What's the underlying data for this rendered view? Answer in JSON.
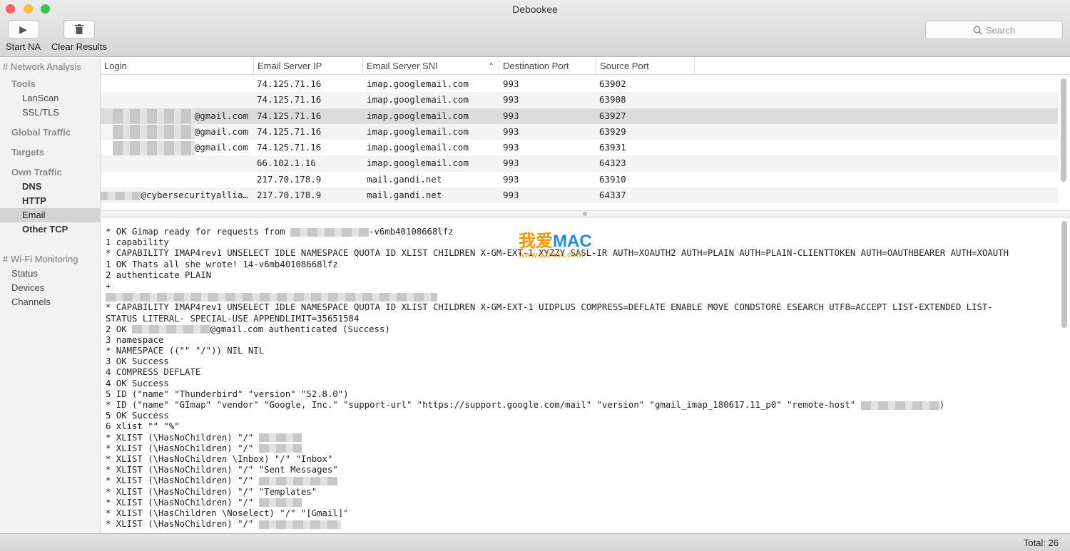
{
  "window": {
    "title": "Debookee"
  },
  "toolbar": {
    "start_label": "Start NA",
    "clear_label": "Clear Results",
    "search_placeholder": "Search"
  },
  "sidebar": {
    "network_analysis": "# Network Analysis",
    "tools": "Tools",
    "lanscan": "LanScan",
    "ssltls": "SSL/TLS",
    "global_traffic": "Global Traffic",
    "targets": "Targets",
    "own_traffic": "Own Traffic",
    "dns": "DNS",
    "http": "HTTP",
    "email": "Email",
    "other_tcp": "Other TCP",
    "wifi": "# Wi-Fi Monitoring",
    "status": "Status",
    "devices": "Devices",
    "channels": "Channels"
  },
  "table": {
    "columns": [
      "Login",
      "Email Server IP",
      "Email Server SNI",
      "Destination Port",
      "Source Port"
    ],
    "sort_column": "Email Server SNI",
    "rows": [
      {
        "login": "",
        "blur": "",
        "ip": "74.125.71.16",
        "sni": "imap.googlemail.com",
        "dport": "993",
        "sport": "63902"
      },
      {
        "login": "",
        "blur": "",
        "ip": "74.125.71.16",
        "sni": "imap.googlemail.com",
        "dport": "993",
        "sport": "63908"
      },
      {
        "login": "@gmail.com",
        "blur": "l",
        "ip": "74.125.71.16",
        "sni": "imap.googlemail.com",
        "dport": "993",
        "sport": "63927",
        "selected": true
      },
      {
        "login": "@gmail.com",
        "blur": "l",
        "ip": "74.125.71.16",
        "sni": "imap.googlemail.com",
        "dport": "993",
        "sport": "63929"
      },
      {
        "login": "@gmail.com",
        "blur": "l",
        "ip": "74.125.71.16",
        "sni": "imap.googlemail.com",
        "dport": "993",
        "sport": "63931"
      },
      {
        "login": "",
        "blur": "",
        "ip": "66.102.1.16",
        "sni": "imap.googlemail.com",
        "dport": "993",
        "sport": "64323"
      },
      {
        "login": "",
        "blur": "",
        "ip": "217.70.178.9",
        "sni": "mail.gandi.net",
        "dport": "993",
        "sport": "63910"
      },
      {
        "login": "@cybersecurityallia…",
        "blur": "s",
        "ip": "217.70.178.9",
        "sni": "mail.gandi.net",
        "dport": "993",
        "sport": "64337"
      }
    ]
  },
  "log": [
    {
      "pre": "* OK Gimap ready for requests from ",
      "blur": "m",
      "post": "-v6mb40108668lfz"
    },
    {
      "pre": "1 capability"
    },
    {
      "pre": "* CAPABILITY IMAP4rev1 UNSELECT IDLE NAMESPACE QUOTA ID XLIST CHILDREN X-GM-EXT-1 XYZZY SASL-IR AUTH=XOAUTH2 AUTH=PLAIN AUTH=PLAIN-CLIENTTOKEN AUTH=OAUTHBEARER AUTH=XOAUTH"
    },
    {
      "pre": "1 OK Thats all she wrote! 14-v6mb40108668lfz"
    },
    {
      "pre": "2 authenticate PLAIN"
    },
    {
      "pre": "+"
    },
    {
      "pre": "",
      "blur": "xl"
    },
    {
      "pre": "* CAPABILITY IMAP4rev1 UNSELECT IDLE NAMESPACE QUOTA ID XLIST CHILDREN X-GM-EXT-1 UIDPLUS COMPRESS=DEFLATE ENABLE MOVE CONDSTORE ESEARCH UTF8=ACCEPT LIST-EXTENDED LIST-"
    },
    {
      "pre": "STATUS LITERAL- SPECIAL-USE APPENDLIMIT=35651584"
    },
    {
      "pre": "2 OK ",
      "blur": "m",
      "post": "@gmail.com authenticated (Success)"
    },
    {
      "pre": "3 namespace"
    },
    {
      "pre": "* NAMESPACE ((\"\" \"/\")) NIL NIL"
    },
    {
      "pre": "3 OK Success"
    },
    {
      "pre": "4 COMPRESS DEFLATE"
    },
    {
      "pre": "4 OK Success"
    },
    {
      "pre": "5 ID (\"name\" \"Thunderbird\" \"version\" \"52.8.0\")"
    },
    {
      "pre": "* ID (\"name\" \"GImap\" \"vendor\" \"Google, Inc.\" \"support-url\" \"https://support.google.com/mail\" \"version\" \"gmail_imap_180617.11_p0\" \"remote-host\" ",
      "blur": "m",
      "post": ")"
    },
    {
      "pre": "5 OK Success"
    },
    {
      "pre": "6 xlist \"\" \"%\""
    },
    {
      "pre": "* XLIST (\\HasNoChildren) \"/\" ",
      "blur": "s"
    },
    {
      "pre": "* XLIST (\\HasNoChildren) \"/\" ",
      "blur": "s"
    },
    {
      "pre": "* XLIST (\\HasNoChildren \\Inbox) \"/\" \"Inbox\""
    },
    {
      "pre": "* XLIST (\\HasNoChildren) \"/\" \"Sent Messages\""
    },
    {
      "pre": "* XLIST (\\HasNoChildren) \"/\" ",
      "blur": "m"
    },
    {
      "pre": "* XLIST (\\HasNoChildren) \"/\" \"Templates\""
    },
    {
      "pre": "* XLIST (\\HasNoChildren) \"/\" ",
      "blur": "s"
    },
    {
      "pre": "* XLIST (\\HasChildren \\Noselect) \"/\" \"[Gmail]\""
    },
    {
      "pre": "* XLIST (\\HasNoChildren) \"/\" ",
      "blur": "l"
    }
  ],
  "watermark": {
    "brand_cn": "我爱",
    "brand": "MAC",
    "url": "www.52mac.com"
  },
  "status": {
    "total": "Total: 26"
  }
}
